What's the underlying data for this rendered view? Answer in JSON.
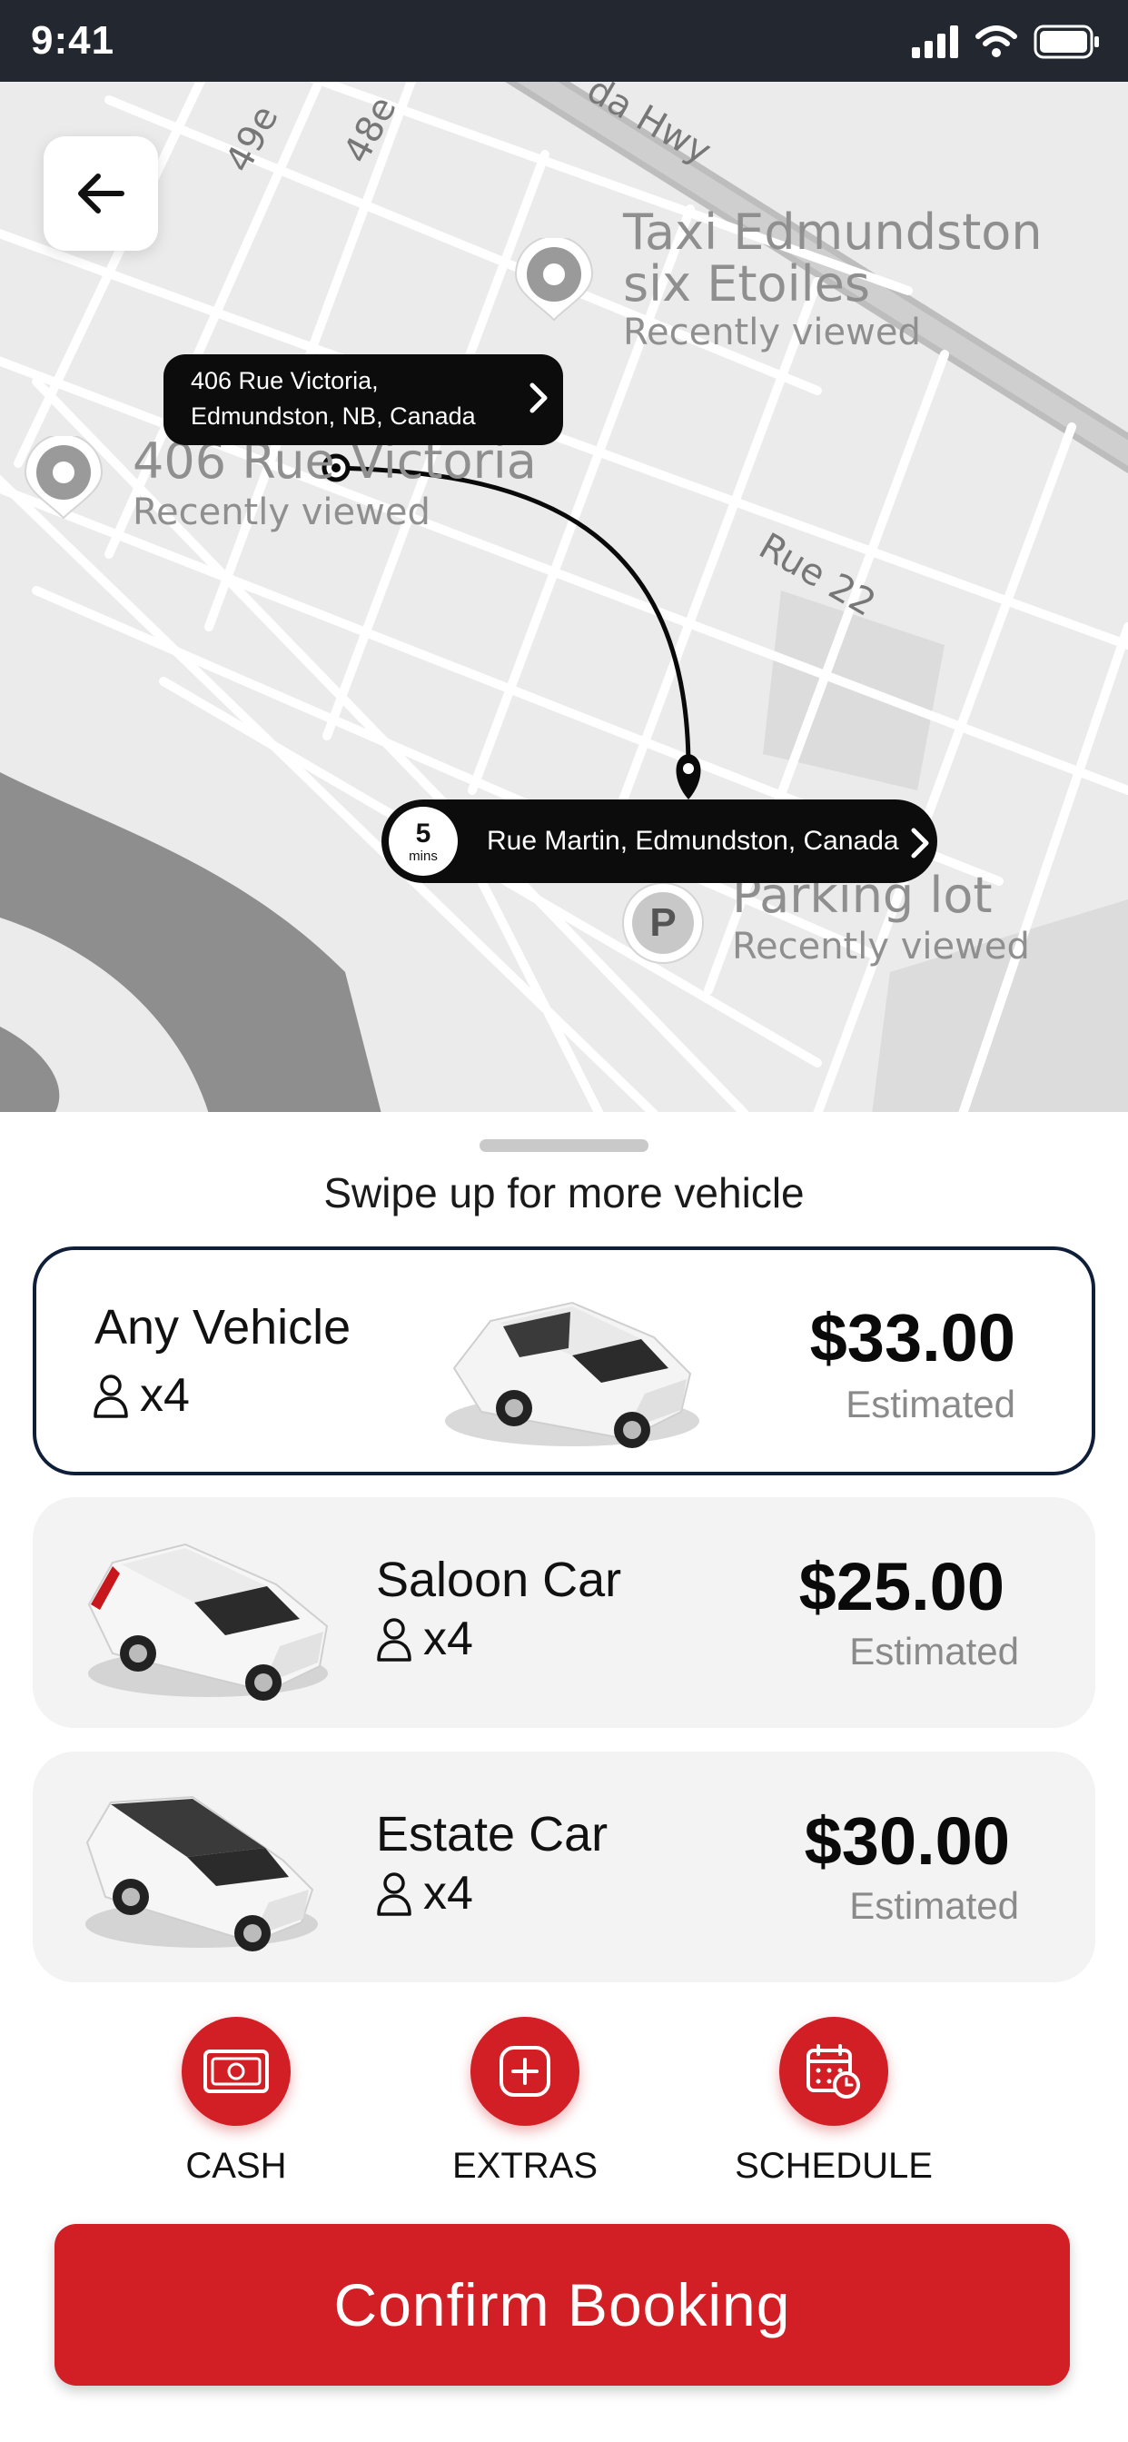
{
  "status_bar": {
    "time": "9:41"
  },
  "map": {
    "road_labels": [
      "49e",
      "48e",
      "da Hwy",
      "Rue 22"
    ],
    "places": [
      {
        "name_line1": "Taxi Edmundston",
        "name_line2": "six Etoiles",
        "sub": "Recently viewed"
      },
      {
        "name_line1": "406 Rue Victoria",
        "sub": "Recently viewed"
      },
      {
        "name_line1": "Parking lot",
        "sub": "Recently viewed",
        "icon_letter": "P"
      }
    ],
    "origin": {
      "line1": "406 Rue Victoria,",
      "line2": "Edmundston, NB, Canada"
    },
    "destination": {
      "eta_value": "5",
      "eta_unit": "mins",
      "address": "Rue Martin, Edmundston, Canada"
    }
  },
  "sheet": {
    "hint": "Swipe up for more vehicle",
    "vehicles": [
      {
        "name": "Any Vehicle",
        "seats": "x4",
        "price": "$33.00",
        "price_note": "Estimated"
      },
      {
        "name": "Saloon Car",
        "seats": "x4",
        "price": "$25.00",
        "price_note": "Estimated"
      },
      {
        "name": "Estate Car",
        "seats": "x4",
        "price": "$30.00",
        "price_note": "Estimated"
      }
    ],
    "actions": [
      {
        "label": "CASH",
        "icon": "cash-icon"
      },
      {
        "label": "EXTRAS",
        "icon": "plus-square-icon"
      },
      {
        "label": "SCHEDULE",
        "icon": "calendar-clock-icon"
      }
    ],
    "confirm_label": "Confirm Booking"
  },
  "colors": {
    "accent": "#d21f26",
    "selected_border": "#0f1f3a",
    "map_bg": "#ebebeb",
    "status_bar": "#23272f"
  }
}
